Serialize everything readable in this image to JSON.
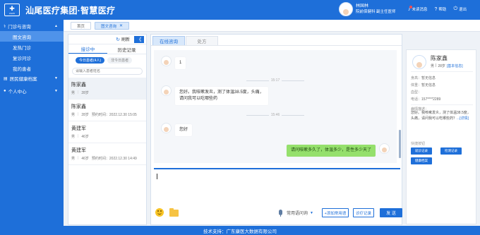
{
  "header": {
    "logo_text": "ZHZD",
    "title": "汕尾医疗集团·智慧医疗",
    "user_name": "林国林",
    "user_role": "院前保健科 副主任医师",
    "actions": {
      "unread": "未读消息",
      "help": "帮助",
      "logout": "退出"
    }
  },
  "sidebar": {
    "group1": "门诊与咨询",
    "items": [
      "图文咨询",
      "发热门诊",
      "复诊问诊",
      "我的患者"
    ],
    "group2": "居民健康档案",
    "group3": "个人中心"
  },
  "page_tabs": {
    "home": "首页",
    "active": "图文咨询"
  },
  "patient_panel": {
    "refresh": "刷新",
    "collapse": "《",
    "tabs": [
      "接诊中",
      "历史记录"
    ],
    "pill_today": "今日患者(4人)",
    "pill_other": "非今日患者",
    "search_placeholder": "请输入患者姓名",
    "patients": [
      {
        "name": "陈家鑫",
        "gender": "男",
        "age": "28岁",
        "time": ""
      },
      {
        "name": "陈家鑫",
        "gender": "男",
        "age": "28岁",
        "time": "预约时间：2022.12.30 15:05"
      },
      {
        "name": "黄建军",
        "gender": "男",
        "age": "46岁",
        "time": ""
      },
      {
        "name": "黄建军",
        "gender": "男",
        "age": "46岁",
        "time": "预约时间：2022.12.30 14:49"
      }
    ]
  },
  "chat": {
    "tabs": [
      "在线咨询",
      "处方"
    ],
    "messages": [
      {
        "text": "1"
      },
      {
        "time": "15:17"
      },
      {
        "line1": "您好。我咳嗽发炎，测了体温38.5度，头痛，",
        "line2": "请问我可以吃哪些药"
      },
      {
        "time": "15:46"
      },
      {
        "text": "您好"
      },
      {
        "text": "请问咳嗽多久了，体温多少，是性多少天了"
      }
    ],
    "phrase": "常用语问询",
    "add_phrase": "+添加常用语",
    "consult_record": "诊疗记录",
    "send": "发 送"
  },
  "info": {
    "name": "陈家鑫",
    "gender": "男",
    "age": "28岁",
    "link": "[基本信息]",
    "rows": [
      {
        "k": "身高：",
        "v": "暂无信息"
      },
      {
        "k": "体重：",
        "v": "暂无信息"
      },
      {
        "k": "血型：",
        "v": ""
      },
      {
        "k": "电话：",
        "v": "157****2289"
      }
    ],
    "desc_title": "病情描述：",
    "desc": "您好。我咳嗽发炎，测了体温38.5度，头痛，请问我可以吃哪些药？",
    "desc_more": "...[详情]",
    "quick_title": "快捷按钮",
    "buttons": [
      "就诊记录",
      "检测记录",
      "健康档案"
    ]
  },
  "footer": "技术支持：广东康医大数据有限公司"
}
